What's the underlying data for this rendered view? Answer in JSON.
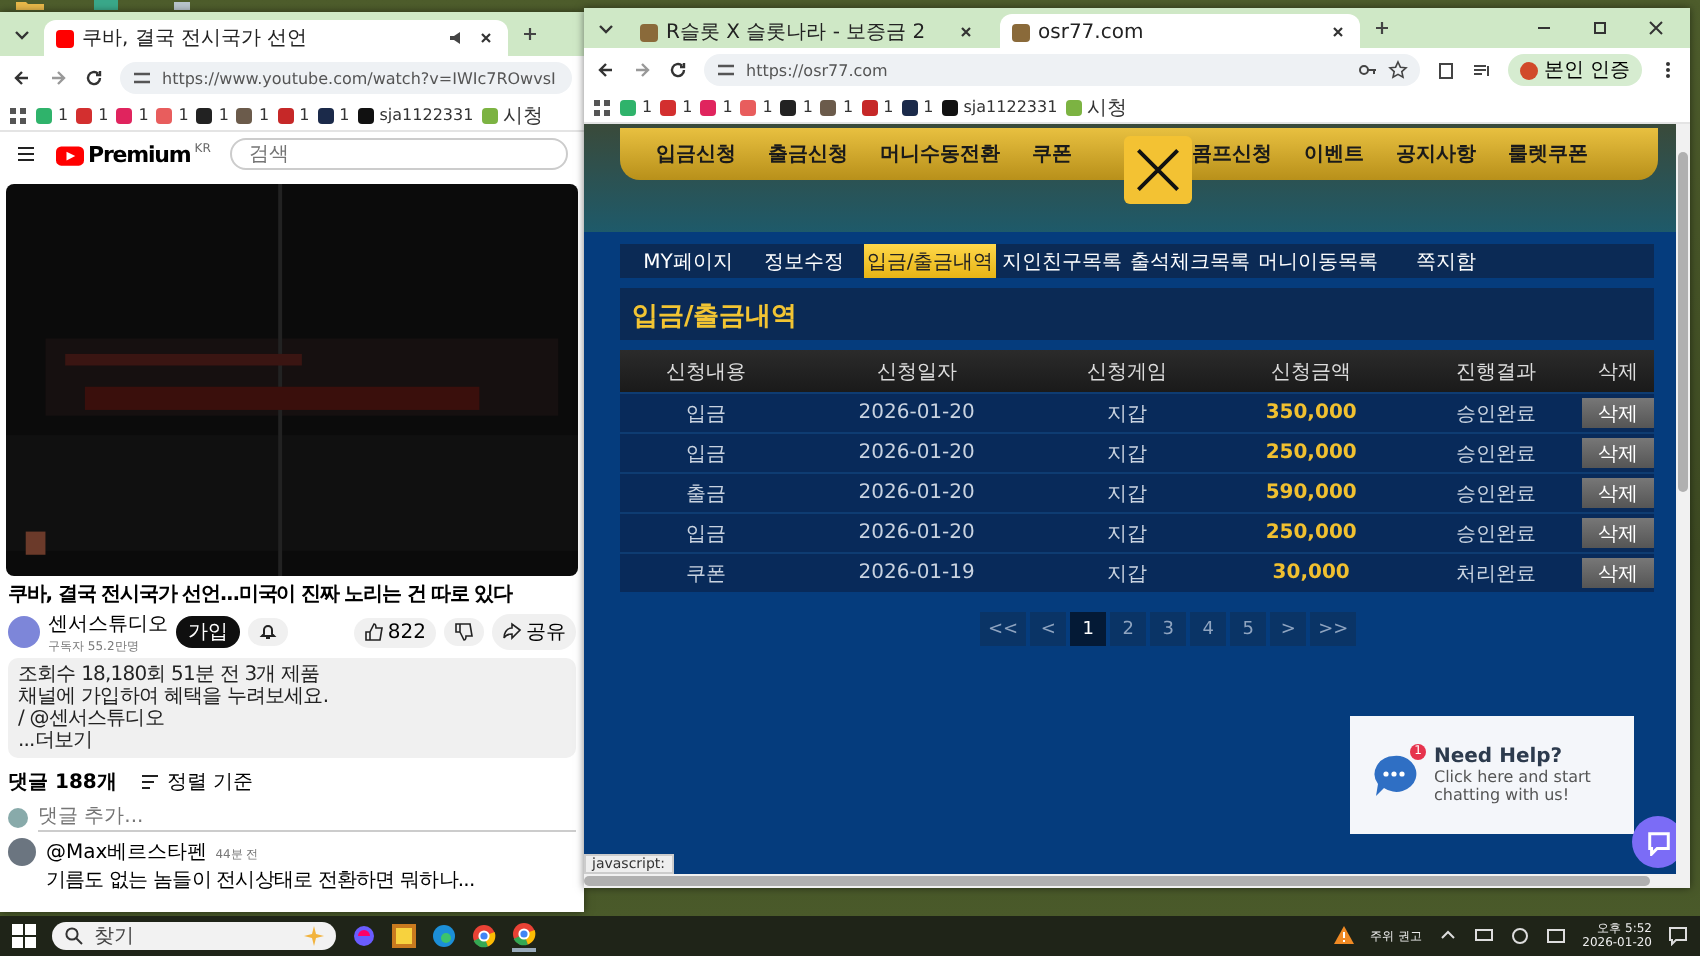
{
  "left_window": {
    "tabs": [
      {
        "title": "쿠바, 결국 전시국가 선언",
        "selected": true
      }
    ],
    "url": "https://www.youtube.com/watch?v=IWIc7ROwvsI",
    "bookmarks": [
      {
        "label": "1",
        "color": "#2fb36b"
      },
      {
        "label": "1",
        "color": "#d32f2f"
      },
      {
        "label": "1",
        "color": "#e0245e"
      },
      {
        "label": "1",
        "color": "#e85d5d"
      },
      {
        "label": "1",
        "color": "#222222"
      },
      {
        "label": "1",
        "color": "#6b5b4b"
      },
      {
        "label": "1",
        "color": "#c62828"
      },
      {
        "label": "1",
        "color": "#1b2a4a"
      },
      {
        "label": "sja1122331",
        "color": "#111111"
      },
      {
        "label": "시청",
        "color": "#7cb342"
      }
    ],
    "youtube": {
      "logo": "Premium",
      "logo_sup": "KR",
      "search_placeholder": "검색",
      "video": {
        "kind": "picture"
      },
      "title": "쿠바, 결국 전시국가 선언...미국이 진짜 노리는 건 따로 있다",
      "channel": "센서스튜디오",
      "subscribers": "구독자 55.2만명",
      "join": "가입",
      "likes": "822",
      "share": "공유",
      "description": [
        "조회수 18,180회  51분 전  3개 제품",
        "채널에 가입하여 혜택을 누려보세요.",
        "/ @센서스튜디오",
        "...더보기"
      ],
      "comments_count": "댓글 188개",
      "sort": "정렬 기준",
      "add_comment_placeholder": "댓글 추가...",
      "comment": {
        "author": "@Max베르스타펜",
        "time": "44분 전",
        "text": "기름도 없는 놈들이 전시상태로 전환하면 뭐하나..."
      }
    }
  },
  "right_window": {
    "tabs": [
      {
        "title": "R슬롯 X 슬롯나라 - 보증금 2",
        "selected": false
      },
      {
        "title": "osr77.com",
        "selected": true
      }
    ],
    "url": "https://osr77.com",
    "profile": "본인 인증",
    "bookmarks": [
      {
        "label": "1",
        "color": "#2fb36b"
      },
      {
        "label": "1",
        "color": "#d32f2f"
      },
      {
        "label": "1",
        "color": "#e0245e"
      },
      {
        "label": "1",
        "color": "#e85d5d"
      },
      {
        "label": "1",
        "color": "#222222"
      },
      {
        "label": "1",
        "color": "#6b5b4b"
      },
      {
        "label": "1",
        "color": "#c62828"
      },
      {
        "label": "1",
        "color": "#1b2a4a"
      },
      {
        "label": "sja1122331",
        "color": "#111111"
      },
      {
        "label": "시청",
        "color": "#7cb342"
      }
    ],
    "site": {
      "nav": [
        "입금신청",
        "출금신청",
        "머니수동전환",
        "쿠폰",
        "콤프신청",
        "이벤트",
        "공지사항",
        "룰렛쿠폰"
      ],
      "mypage_tabs": [
        {
          "label": "MY페이지",
          "selected": false
        },
        {
          "label": "정보수정",
          "selected": false
        },
        {
          "label": "입금/출금내역",
          "selected": true
        },
        {
          "label": "지인친구목록",
          "selected": false
        },
        {
          "label": "출석체크목록",
          "selected": false
        },
        {
          "label": "머니이동목록",
          "selected": false
        },
        {
          "label": "쪽지함",
          "selected": false
        }
      ],
      "heading": "입금/출금내역",
      "table": {
        "columns": [
          "신청내용",
          "신청일자",
          "신청게임",
          "신청금액",
          "진행결과",
          "삭제"
        ],
        "rows": [
          {
            "type": "입금",
            "date": "2026-01-20",
            "game": "지갑",
            "amount": "350,000",
            "result": "승인완료",
            "action": "삭제"
          },
          {
            "type": "입금",
            "date": "2026-01-20",
            "game": "지갑",
            "amount": "250,000",
            "result": "승인완료",
            "action": "삭제"
          },
          {
            "type": "출금",
            "date": "2026-01-20",
            "game": "지갑",
            "amount": "590,000",
            "result": "승인완료",
            "action": "삭제"
          },
          {
            "type": "입금",
            "date": "2026-01-20",
            "game": "지갑",
            "amount": "250,000",
            "result": "승인완료",
            "action": "삭제"
          },
          {
            "type": "쿠폰",
            "date": "2026-01-19",
            "game": "지갑",
            "amount": "30,000",
            "result": "처리완료",
            "action": "삭제"
          }
        ]
      },
      "pagination": [
        {
          "label": "<<",
          "selected": false
        },
        {
          "label": "<",
          "selected": false
        },
        {
          "label": "1",
          "selected": true
        },
        {
          "label": "2",
          "selected": false
        },
        {
          "label": "3",
          "selected": false
        },
        {
          "label": "4",
          "selected": false
        },
        {
          "label": "5",
          "selected": false
        },
        {
          "label": ">",
          "selected": false
        },
        {
          "label": ">>",
          "selected": false
        }
      ],
      "help": {
        "title": "Need Help?",
        "text": "Click here and start chatting with us!",
        "badge": "1"
      }
    },
    "status": "javascript:"
  },
  "taskbar": {
    "search_placeholder": "찾기",
    "alert": "주위 권고",
    "time": "오후 5:52",
    "date": "2026-01-20"
  }
}
